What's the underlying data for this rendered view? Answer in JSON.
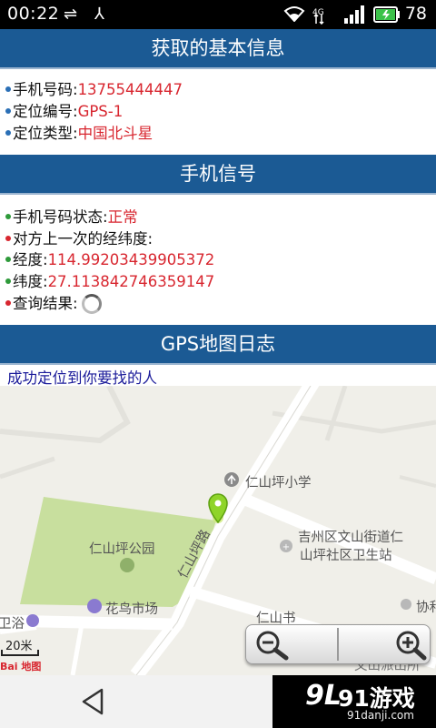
{
  "status_bar": {
    "time": "00:22",
    "network": "4G",
    "battery": "78"
  },
  "basic_info": {
    "title": "获取的基本信息",
    "phone_label": "手机号码:",
    "phone_value": "13755444447",
    "locate_id_label": "定位编号:",
    "locate_id_value": "GPS-1",
    "locate_type_label": "定位类型:",
    "locate_type_value": "中国北斗星"
  },
  "signal": {
    "title": "手机信号",
    "status_label": "手机号码状态:",
    "status_value": "正常",
    "last_coord_label": "对方上一次的经纬度:",
    "lng_label": "经度:",
    "lng_value": "114.99203439905372",
    "lat_label": "纬度:",
    "lat_value": "27.113842746359147",
    "query_label": "查询结果:"
  },
  "gps_log": {
    "title": "GPS地图日志",
    "message": "成功定位到你要找的人"
  },
  "map": {
    "labels": {
      "school": "仁山坪小学",
      "health_station": "吉州区文山街道仁山坪社区卫生站",
      "health_station_line1": "吉州区文山街道仁",
      "health_station_line2": "山坪社区卫生站",
      "park": "仁山坪公园",
      "flower_market": "花鸟市场",
      "road": "仁山坪路",
      "road2": "仁山书",
      "bath": "卫浴",
      "xie": "协和",
      "bottom_poi": "文山派出所",
      "scale": "20米",
      "logo": "Bai 地图"
    },
    "zoom_out": "zoom-out",
    "zoom_in": "zoom-in"
  },
  "watermark": {
    "main": "91游戏",
    "sub": "91danji.com",
    "logo": "9L"
  },
  "colors": {
    "header": "#1b5a94",
    "value_text": "#d8262f",
    "message_text": "#1b1b9a",
    "park": "#c8df9e",
    "marker": "#8fd42a"
  }
}
